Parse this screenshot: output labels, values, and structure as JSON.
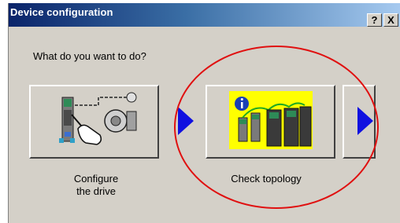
{
  "dialog": {
    "title": "Device configuration",
    "help_label": "?",
    "close_label": "X"
  },
  "prompt": "What do you want to do?",
  "options": [
    {
      "label_line1": "Configure",
      "label_line2": "the drive",
      "icon": "configure-drive-icon"
    },
    {
      "label": "Check topology",
      "icon": "check-topology-icon"
    }
  ],
  "next_icon": "next-arrow-icon",
  "colors": {
    "title_start": "#0a246a",
    "title_end": "#a6caf0",
    "dialog_bg": "#d4d0c8",
    "arrow": "#1010e0",
    "highlight_ellipse": "#e01010",
    "topology_bg": "#ffff00"
  }
}
